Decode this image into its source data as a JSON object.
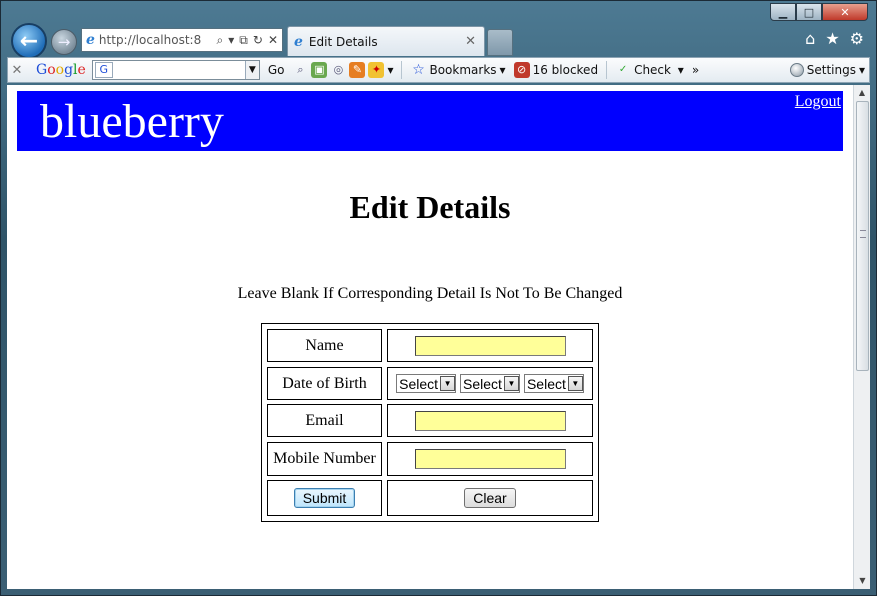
{
  "window": {
    "controls": {
      "minimize": "▁",
      "maximize": "□",
      "close": "✕"
    }
  },
  "nav": {
    "back_glyph": "←",
    "forward_glyph": "→",
    "address": "http://localhost:8",
    "address_icons": [
      "⌕",
      "▾",
      "⧉",
      "↻",
      "✕"
    ],
    "tab_title": "Edit Details",
    "tab_close": "✕",
    "right_icons": [
      "⌂",
      "★",
      "⚙"
    ]
  },
  "toolbar": {
    "close": "✕",
    "google_letters": [
      "G",
      "o",
      "o",
      "g",
      "l",
      "e"
    ],
    "google_box_glyph": "G",
    "go_label": "Go",
    "more_glyph": "▾",
    "bookmarks_label": "Bookmarks",
    "blocked_label": "16 blocked",
    "check_label": "Check",
    "overflow_glyph": "»",
    "settings_label": "Settings"
  },
  "page": {
    "brand": "blueberry",
    "logout": "Logout",
    "title": "Edit Details",
    "note": "Leave Blank If Corresponding Detail Is Not To Be Changed",
    "form": {
      "name_label": "Name",
      "dob_label": "Date of Birth",
      "dob_selects": [
        "Select",
        "Select",
        "Select"
      ],
      "email_label": "Email",
      "mobile_label": "Mobile Number",
      "submit": "Submit",
      "clear": "Clear"
    }
  },
  "colors": {
    "banner": "#0000ff",
    "input_bg": "#ffff99"
  }
}
